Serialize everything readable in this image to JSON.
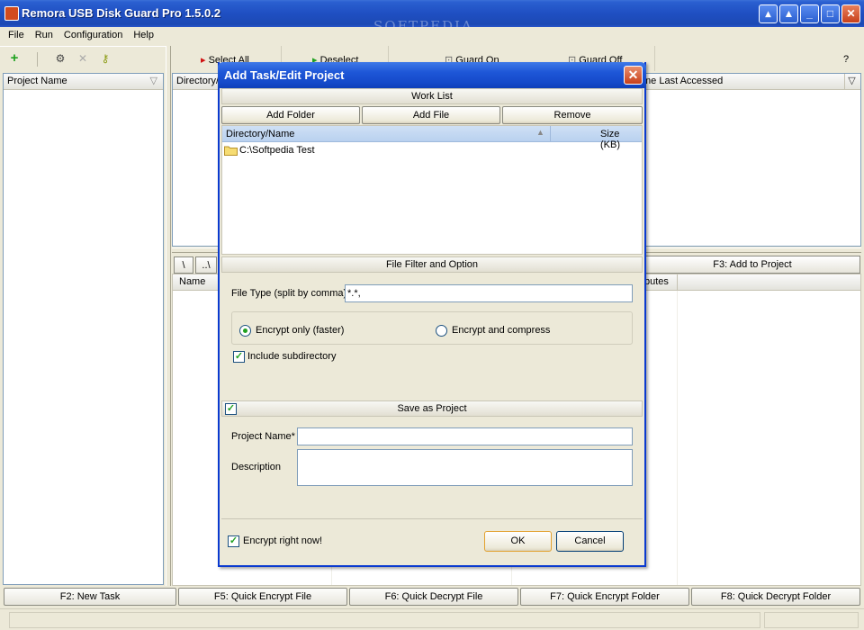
{
  "window": {
    "title": "Remora USB Disk Guard Pro 1.5.0.2",
    "watermark": "SOFTPEDIA"
  },
  "menu": [
    "File",
    "Run",
    "Configuration",
    "Help"
  ],
  "toolbar": {
    "select_all": "Select All",
    "deselect": "Deselect",
    "guard_on": "Guard On",
    "guard_off": "Guard Off",
    "help": "?"
  },
  "left_panel": {
    "header": "Project Name"
  },
  "top_list": {
    "col_directory": "Directory/",
    "col_last_accessed": "me Last Accessed"
  },
  "browser": {
    "root_btn": "\\",
    "up_btn": "..\\",
    "add_to_project": "F3: Add to Project",
    "col_name": "Name",
    "col_attributes": "butes"
  },
  "function_keys": [
    "F2: New Task",
    "F5: Quick Encrypt File",
    "F6: Quick Decrypt File",
    "F7: Quick Encrypt Folder",
    "F8: Quick Decrypt Folder"
  ],
  "dialog": {
    "title": "Add Task/Edit Project",
    "close": "✕",
    "work_list": {
      "header": "Work List",
      "add_folder": "Add Folder",
      "add_file": "Add File",
      "remove": "Remove",
      "col_name": "Directory/Name",
      "col_size": "Size (KB)",
      "items": [
        {
          "name": "C:\\Softpedia Test",
          "size": ""
        }
      ]
    },
    "filter": {
      "header": "File Filter and Option",
      "file_type_label": "File Type (split by comma)",
      "file_type_value": "*.*,",
      "encrypt_only": "Encrypt only (faster)",
      "encrypt_compress": "Encrypt and compress",
      "include_subdir": "Include subdirectory",
      "encrypt_only_selected": true,
      "include_subdir_checked": true
    },
    "project": {
      "header": "Save as Project",
      "save_checked": true,
      "name_label": "Project Name*",
      "name_value": "",
      "description_label": "Description",
      "description_value": ""
    },
    "encrypt_now": "Encrypt right now!",
    "encrypt_now_checked": true,
    "ok": "OK",
    "cancel": "Cancel"
  }
}
